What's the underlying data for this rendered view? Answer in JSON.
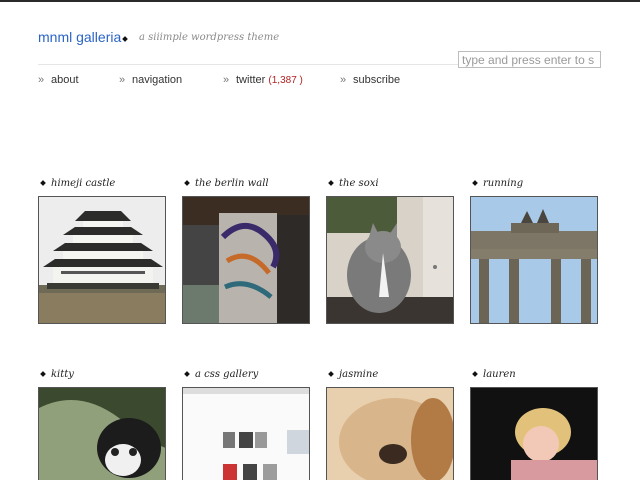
{
  "site": {
    "title": "mnml galleria",
    "tagline": "a siiimple wordpress theme"
  },
  "search": {
    "placeholder": "type and press enter to s"
  },
  "nav": {
    "about": "about",
    "navigation": "navigation",
    "twitter": "twitter",
    "twitter_count": "(1,387 )",
    "subscribe": "subscribe"
  },
  "posts": [
    {
      "title": "himeji castle"
    },
    {
      "title": "the berlin wall"
    },
    {
      "title": "the soxi"
    },
    {
      "title": "running"
    },
    {
      "title": "kitty"
    },
    {
      "title": "a css gallery"
    },
    {
      "title": "jasmine"
    },
    {
      "title": "lauren"
    }
  ],
  "colors": {
    "title_link": "#2a64c5",
    "twitter_count": "#b22222"
  }
}
